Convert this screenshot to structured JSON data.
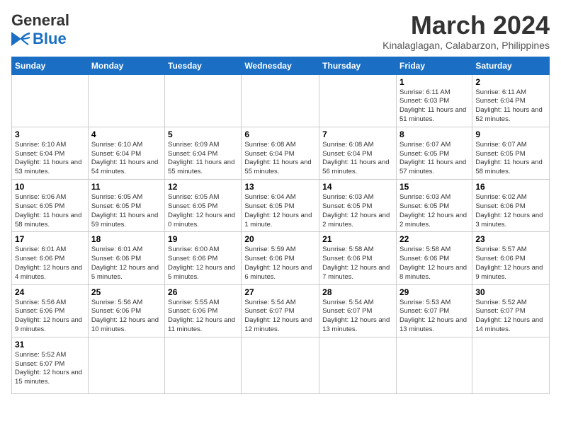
{
  "logo": {
    "text_general": "General",
    "text_blue": "Blue"
  },
  "header": {
    "month": "March 2024",
    "location": "Kinalaglagan, Calabarzon, Philippines"
  },
  "columns": [
    "Sunday",
    "Monday",
    "Tuesday",
    "Wednesday",
    "Thursday",
    "Friday",
    "Saturday"
  ],
  "weeks": [
    [
      {
        "day": "",
        "info": ""
      },
      {
        "day": "",
        "info": ""
      },
      {
        "day": "",
        "info": ""
      },
      {
        "day": "",
        "info": ""
      },
      {
        "day": "",
        "info": ""
      },
      {
        "day": "1",
        "info": "Sunrise: 6:11 AM\nSunset: 6:03 PM\nDaylight: 11 hours and 51 minutes."
      },
      {
        "day": "2",
        "info": "Sunrise: 6:11 AM\nSunset: 6:04 PM\nDaylight: 11 hours and 52 minutes."
      }
    ],
    [
      {
        "day": "3",
        "info": "Sunrise: 6:10 AM\nSunset: 6:04 PM\nDaylight: 11 hours and 53 minutes."
      },
      {
        "day": "4",
        "info": "Sunrise: 6:10 AM\nSunset: 6:04 PM\nDaylight: 11 hours and 54 minutes."
      },
      {
        "day": "5",
        "info": "Sunrise: 6:09 AM\nSunset: 6:04 PM\nDaylight: 11 hours and 55 minutes."
      },
      {
        "day": "6",
        "info": "Sunrise: 6:08 AM\nSunset: 6:04 PM\nDaylight: 11 hours and 55 minutes."
      },
      {
        "day": "7",
        "info": "Sunrise: 6:08 AM\nSunset: 6:04 PM\nDaylight: 11 hours and 56 minutes."
      },
      {
        "day": "8",
        "info": "Sunrise: 6:07 AM\nSunset: 6:05 PM\nDaylight: 11 hours and 57 minutes."
      },
      {
        "day": "9",
        "info": "Sunrise: 6:07 AM\nSunset: 6:05 PM\nDaylight: 11 hours and 58 minutes."
      }
    ],
    [
      {
        "day": "10",
        "info": "Sunrise: 6:06 AM\nSunset: 6:05 PM\nDaylight: 11 hours and 58 minutes."
      },
      {
        "day": "11",
        "info": "Sunrise: 6:05 AM\nSunset: 6:05 PM\nDaylight: 11 hours and 59 minutes."
      },
      {
        "day": "12",
        "info": "Sunrise: 6:05 AM\nSunset: 6:05 PM\nDaylight: 12 hours and 0 minutes."
      },
      {
        "day": "13",
        "info": "Sunrise: 6:04 AM\nSunset: 6:05 PM\nDaylight: 12 hours and 1 minute."
      },
      {
        "day": "14",
        "info": "Sunrise: 6:03 AM\nSunset: 6:05 PM\nDaylight: 12 hours and 2 minutes."
      },
      {
        "day": "15",
        "info": "Sunrise: 6:03 AM\nSunset: 6:05 PM\nDaylight: 12 hours and 2 minutes."
      },
      {
        "day": "16",
        "info": "Sunrise: 6:02 AM\nSunset: 6:06 PM\nDaylight: 12 hours and 3 minutes."
      }
    ],
    [
      {
        "day": "17",
        "info": "Sunrise: 6:01 AM\nSunset: 6:06 PM\nDaylight: 12 hours and 4 minutes."
      },
      {
        "day": "18",
        "info": "Sunrise: 6:01 AM\nSunset: 6:06 PM\nDaylight: 12 hours and 5 minutes."
      },
      {
        "day": "19",
        "info": "Sunrise: 6:00 AM\nSunset: 6:06 PM\nDaylight: 12 hours and 5 minutes."
      },
      {
        "day": "20",
        "info": "Sunrise: 5:59 AM\nSunset: 6:06 PM\nDaylight: 12 hours and 6 minutes."
      },
      {
        "day": "21",
        "info": "Sunrise: 5:58 AM\nSunset: 6:06 PM\nDaylight: 12 hours and 7 minutes."
      },
      {
        "day": "22",
        "info": "Sunrise: 5:58 AM\nSunset: 6:06 PM\nDaylight: 12 hours and 8 minutes."
      },
      {
        "day": "23",
        "info": "Sunrise: 5:57 AM\nSunset: 6:06 PM\nDaylight: 12 hours and 9 minutes."
      }
    ],
    [
      {
        "day": "24",
        "info": "Sunrise: 5:56 AM\nSunset: 6:06 PM\nDaylight: 12 hours and 9 minutes."
      },
      {
        "day": "25",
        "info": "Sunrise: 5:56 AM\nSunset: 6:06 PM\nDaylight: 12 hours and 10 minutes."
      },
      {
        "day": "26",
        "info": "Sunrise: 5:55 AM\nSunset: 6:06 PM\nDaylight: 12 hours and 11 minutes."
      },
      {
        "day": "27",
        "info": "Sunrise: 5:54 AM\nSunset: 6:07 PM\nDaylight: 12 hours and 12 minutes."
      },
      {
        "day": "28",
        "info": "Sunrise: 5:54 AM\nSunset: 6:07 PM\nDaylight: 12 hours and 13 minutes."
      },
      {
        "day": "29",
        "info": "Sunrise: 5:53 AM\nSunset: 6:07 PM\nDaylight: 12 hours and 13 minutes."
      },
      {
        "day": "30",
        "info": "Sunrise: 5:52 AM\nSunset: 6:07 PM\nDaylight: 12 hours and 14 minutes."
      }
    ],
    [
      {
        "day": "31",
        "info": "Sunrise: 5:52 AM\nSunset: 6:07 PM\nDaylight: 12 hours and 15 minutes."
      },
      {
        "day": "",
        "info": ""
      },
      {
        "day": "",
        "info": ""
      },
      {
        "day": "",
        "info": ""
      },
      {
        "day": "",
        "info": ""
      },
      {
        "day": "",
        "info": ""
      },
      {
        "day": "",
        "info": ""
      }
    ]
  ]
}
